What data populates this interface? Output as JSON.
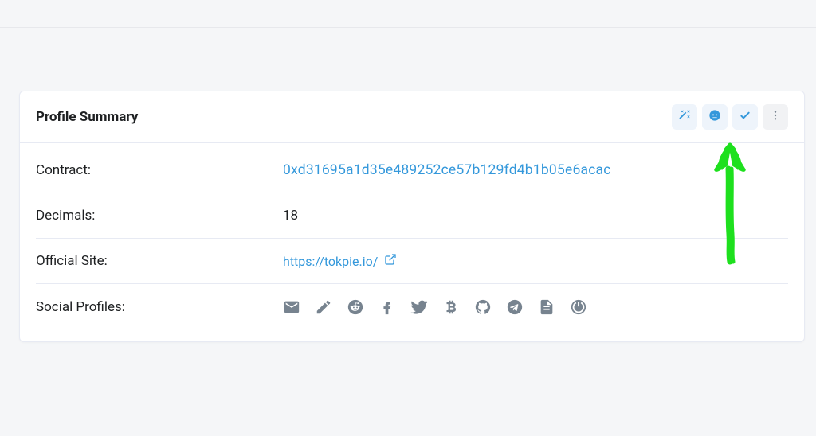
{
  "card": {
    "title": "Profile Summary",
    "header_icons": {
      "magic": "magic-wand-icon",
      "face": "face-icon",
      "check": "check-icon",
      "more": "more-vertical-icon"
    },
    "rows": {
      "contract": {
        "label": "Contract:",
        "value": "0xd31695a1d35e489252ce57b129fd4b1b05e6acac"
      },
      "decimals": {
        "label": "Decimals:",
        "value": "18"
      },
      "official_site": {
        "label": "Official Site:",
        "value": "https://tokpie.io/"
      },
      "social": {
        "label": "Social Profiles:",
        "icons": [
          "email-icon",
          "pencil-icon",
          "reddit-icon",
          "facebook-icon",
          "twitter-icon",
          "bitcoin-icon",
          "github-icon",
          "telegram-icon",
          "document-icon",
          "speedometer-icon"
        ]
      }
    }
  },
  "annotation": {
    "arrow_color": "#1ee01e"
  }
}
